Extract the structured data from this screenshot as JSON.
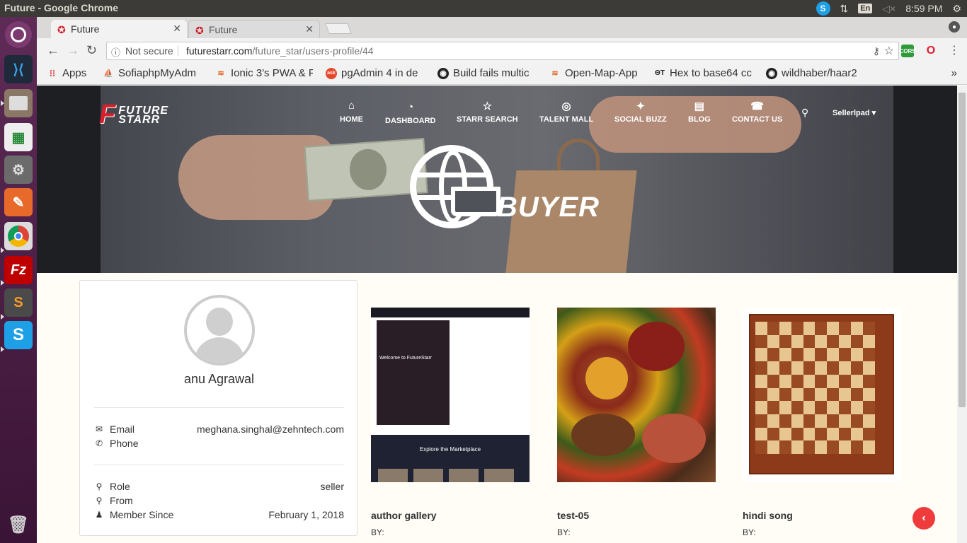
{
  "window": {
    "title": "Future - Google Chrome"
  },
  "tray": {
    "skype": "S",
    "lang": "En",
    "time": "8:59 PM"
  },
  "launcher": {
    "items": [
      "ubuntu-dash",
      "vscode",
      "files",
      "libreoffice-calc",
      "settings",
      "postman",
      "chrome",
      "filezilla",
      "sublime-text",
      "skype",
      "trash"
    ]
  },
  "tabs": [
    {
      "title": "Future",
      "active": true
    },
    {
      "title": "Future",
      "active": false
    }
  ],
  "omnibox": {
    "security": "Not secure",
    "url_host": "futurestarr.com",
    "url_path": "/future_star/users-profile/44"
  },
  "extensions": [
    {
      "label": "CORS",
      "color": "#2e9b3a"
    },
    {
      "label": "O",
      "color": "#e0192a"
    }
  ],
  "bookmarks": [
    {
      "label": "Apps",
      "icon": "apps-grid-icon"
    },
    {
      "label": "SofiaphpMyAdm",
      "icon": "phpmyadmin-icon"
    },
    {
      "label": "Ionic 3's PWA & F",
      "icon": "ionic-icon"
    },
    {
      "label": "pgAdmin 4 in de",
      "icon": "ask-icon"
    },
    {
      "label": "Build fails multic",
      "icon": "github-icon"
    },
    {
      "label": "Open-Map-App",
      "icon": "ionic-icon"
    },
    {
      "label": "Hex to base64 cc",
      "icon": "hex-icon"
    },
    {
      "label": "wildhaber/haar2",
      "icon": "github-icon"
    }
  ],
  "site": {
    "logo": {
      "line1": "FUTURE",
      "line2": "STARR"
    },
    "nav": [
      {
        "label": "HOME",
        "icon": "⌂"
      },
      {
        "label": "DASHBOARD",
        "icon": "◔"
      },
      {
        "label": "STARR SEARCH",
        "icon": "☆"
      },
      {
        "label": "TALENT MALL",
        "icon": "◎"
      },
      {
        "label": "SOCIAL BUZZ",
        "icon": "✦"
      },
      {
        "label": "BLOG",
        "icon": "▤"
      },
      {
        "label": "CONTACT US",
        "icon": "☎"
      }
    ],
    "user_menu": "Sellerlpad ▾",
    "hero_text": "BUYER"
  },
  "profile": {
    "name": "anu Agrawal",
    "email_label": "Email",
    "email": "meghana.singhal@zehntech.com",
    "phone_label": "Phone",
    "phone": "",
    "role_label": "Role",
    "role": "seller",
    "from_label": "From",
    "from": "",
    "member_label": "Member Since",
    "member_since": "February 1, 2018"
  },
  "products": [
    {
      "title": "author gallery",
      "by": "BY:",
      "image": "website-screenshot"
    },
    {
      "title": "test-05",
      "by": "BY:",
      "image": "food-photo"
    },
    {
      "title": "hindi song",
      "by": "BY:",
      "image": "chessboard"
    }
  ],
  "screenshot_inner": {
    "headline": "Welcome to FutureStarr",
    "explore": "Explore the Marketplace"
  }
}
